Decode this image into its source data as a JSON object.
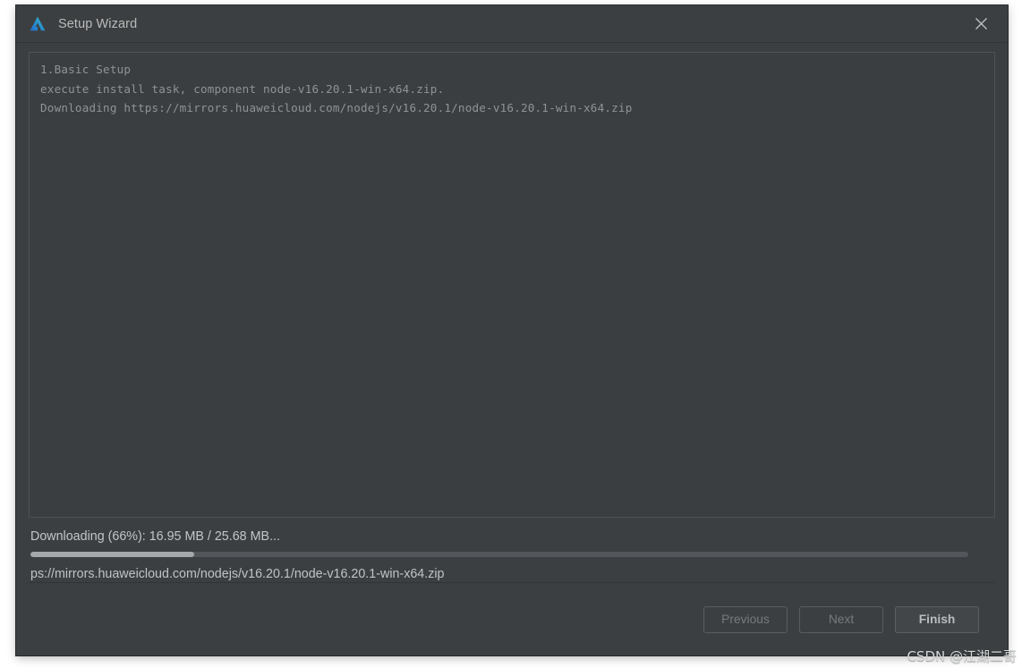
{
  "window": {
    "title": "Setup Wizard",
    "app_icon": "app-logo-icon",
    "close_icon": "close-icon",
    "background_color": "#3c3f41",
    "accent_color": "#3aa0d8"
  },
  "console": {
    "lines": [
      "1.Basic Setup",
      "execute install task, component node-v16.20.1-win-x64.zip.",
      "Downloading https://mirrors.huaweicloud.com/nodejs/v16.20.1/node-v16.20.1-win-x64.zip"
    ],
    "text_color": "#8f9396"
  },
  "progress": {
    "label": "Downloading (66%): 16.95 MB / 25.68 MB...",
    "percent": 66,
    "bar_fill_ratio": 17.5,
    "sub_label": "ps://mirrors.huaweicloud.com/nodejs/v16.20.1/node-v16.20.1-win-x64.zip",
    "fill_color": "#a6a9ab",
    "track_color": "#53565a"
  },
  "footer": {
    "buttons": [
      {
        "label": "Previous",
        "state": "disabled"
      },
      {
        "label": "Next",
        "state": "disabled"
      },
      {
        "label": "Finish",
        "state": "enabled"
      }
    ]
  },
  "watermark": {
    "text": "CSDN @江湖二哥"
  }
}
